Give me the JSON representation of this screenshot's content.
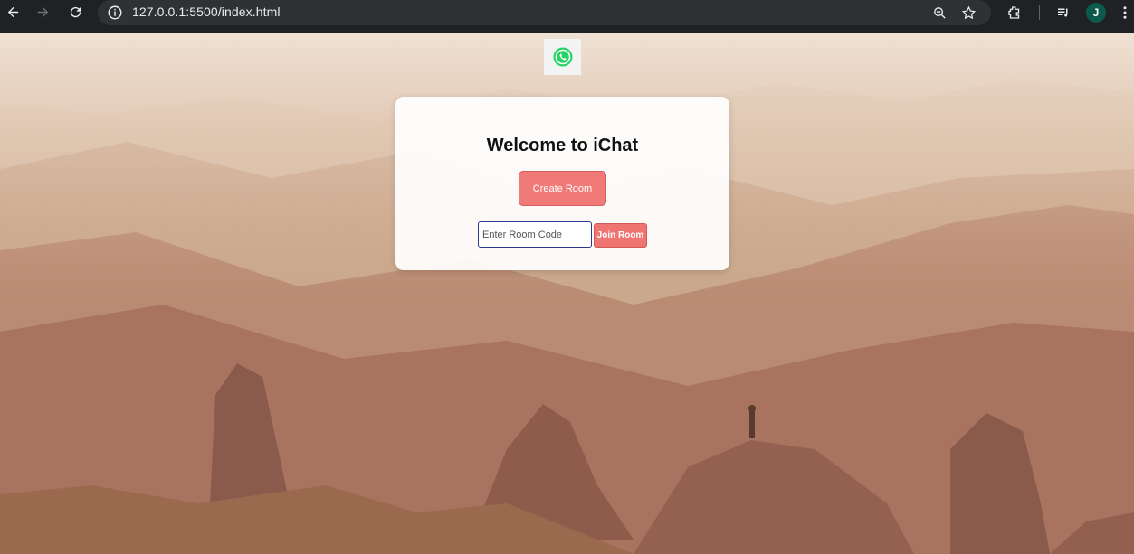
{
  "browser": {
    "url": "127.0.0.1:5500/index.html",
    "profile_initial": "J",
    "icons": [
      "back-icon",
      "forward-icon",
      "reload-icon",
      "site-info-icon",
      "zoom-icon",
      "bookmark-star-icon",
      "extensions-icon",
      "media-queue-icon",
      "menu-icon"
    ]
  },
  "page": {
    "logo_icon": "whatsapp-icon",
    "title": "Welcome to iChat",
    "create_label": "Create Room",
    "room_input_placeholder": "Enter Room Code",
    "room_input_value": "",
    "join_label": "Join Room"
  },
  "colors": {
    "accent": "#f07a78",
    "input_border": "#2a3b8f",
    "chrome_bg": "#202124",
    "profile_bg": "#0b5a4d"
  }
}
